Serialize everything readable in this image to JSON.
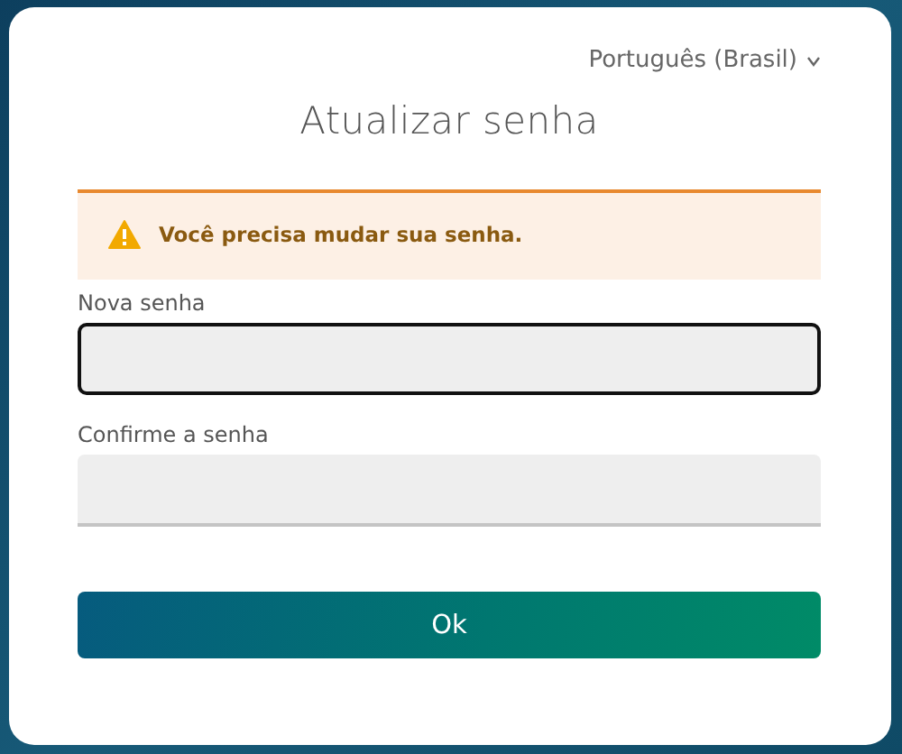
{
  "language": {
    "label": "Português (Brasil)"
  },
  "title": "Atualizar senha",
  "alert": {
    "kind": "warning",
    "message": "Você precisa mudar sua senha."
  },
  "fields": [
    {
      "label": "Nova senha",
      "focused": true
    },
    {
      "label": "Confirme a senha",
      "focused": false
    }
  ],
  "buttons": [
    "Ok"
  ]
}
